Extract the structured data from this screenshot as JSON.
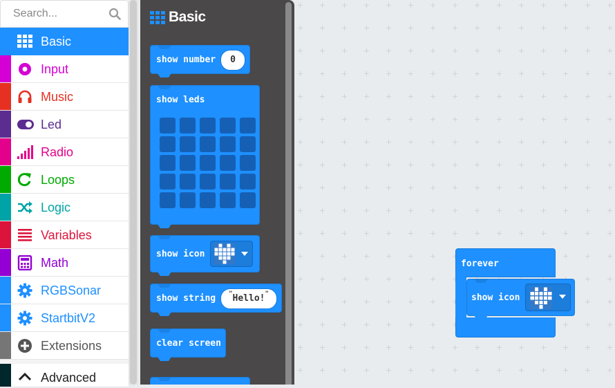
{
  "search": {
    "placeholder": "Search..."
  },
  "categories": [
    {
      "label": "Basic",
      "icon": "grid-icon",
      "color": "#1e90ff",
      "selected": true
    },
    {
      "label": "Input",
      "icon": "input-circle-icon",
      "color": "#d400d4"
    },
    {
      "label": "Music",
      "icon": "headphones-icon",
      "color": "#e63022"
    },
    {
      "label": "Led",
      "icon": "toggle-icon",
      "color": "#5c2d91"
    },
    {
      "label": "Radio",
      "icon": "signal-bars-icon",
      "color": "#e3008c"
    },
    {
      "label": "Loops",
      "icon": "loop-arrow-icon",
      "color": "#00aa00"
    },
    {
      "label": "Logic",
      "icon": "shuffle-icon",
      "color": "#00a4a6"
    },
    {
      "label": "Variables",
      "icon": "list-lines-icon",
      "color": "#dc143c"
    },
    {
      "label": "Math",
      "icon": "calculator-icon",
      "color": "#9400d3"
    },
    {
      "label": "RGBSonar",
      "icon": "gear-icon",
      "color": "#1e90ff"
    },
    {
      "label": "StartbitV2",
      "icon": "gear-icon",
      "color": "#1e90ff"
    },
    {
      "label": "Extensions",
      "icon": "plus-circle-icon",
      "color": "#767676"
    },
    {
      "label": "Advanced",
      "icon": "chevron-up-icon",
      "color": "#00272b"
    }
  ],
  "flyout": {
    "title": "Basic",
    "blocks": {
      "show_number": {
        "label": "show number",
        "value": "0"
      },
      "show_leds": {
        "label": "show leds"
      },
      "show_icon": {
        "label": "show icon"
      },
      "show_string": {
        "label": "show string",
        "value": "Hello!"
      },
      "clear_screen": {
        "label": "clear screen"
      }
    }
  },
  "workspace": {
    "forever": {
      "label": "forever",
      "inner": {
        "label": "show icon"
      }
    }
  },
  "colors": {
    "block": "#1e90ff",
    "flyout_bg": "#4a4849",
    "workspace_bg": "#e9ecef"
  }
}
